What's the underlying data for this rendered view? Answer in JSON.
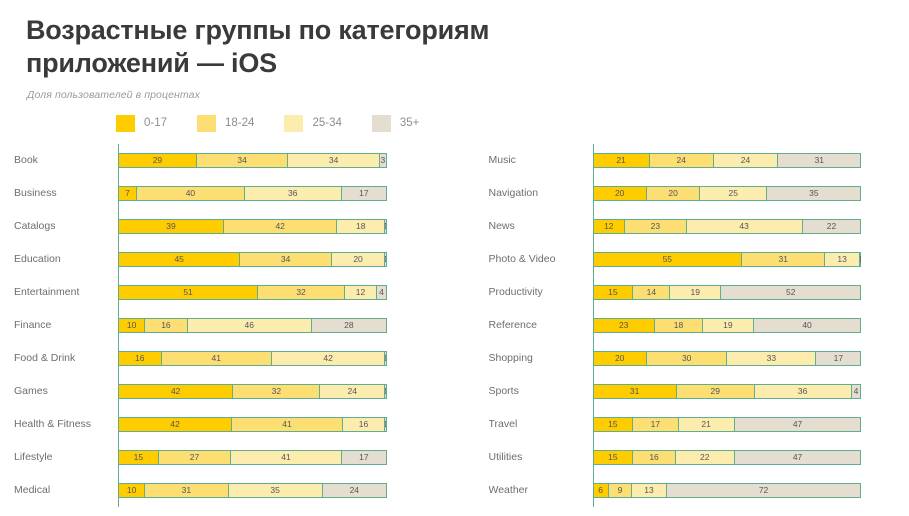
{
  "header": {
    "title": "Возрастные группы по категориям приложений — iOS",
    "subtitle": "Доля пользователей в процентах"
  },
  "legend": [
    {
      "label": "0-17",
      "color": "#FFCC00"
    },
    {
      "label": "18-24",
      "color": "#FCDE72"
    },
    {
      "label": "25-34",
      "color": "#FCEDAE"
    },
    {
      "label": "35+",
      "color": "#E4DDD0"
    }
  ],
  "chart_data": {
    "type": "bar",
    "subtype": "stacked-horizontal-100pct",
    "title": "Возрастные группы по категориям приложений — iOS",
    "subtitle": "Доля пользователей в процентах",
    "xlabel": "",
    "ylabel": "",
    "xlim": [
      0,
      100
    ],
    "unit": "%",
    "grid": false,
    "legend_position": "top",
    "series": [
      {
        "name": "0-17",
        "color": "#FFCC00"
      },
      {
        "name": "18-24",
        "color": "#FCDE72"
      },
      {
        "name": "25-34",
        "color": "#FCEDAE"
      },
      {
        "name": "35+",
        "color": "#E4DDD0"
      }
    ],
    "categories": [
      "Book",
      "Business",
      "Catalogs",
      "Education",
      "Entertainment",
      "Finance",
      "Food & Drink",
      "Games",
      "Health & Fitness",
      "Lifestyle",
      "Medical",
      "Music",
      "Navigation",
      "News",
      "Photo & Video",
      "Productivity",
      "Reference",
      "Shopping",
      "Sports",
      "Travel",
      "Utilities",
      "Weather"
    ],
    "columns": [
      {
        "rows": [
          {
            "label": "Book",
            "values": [
              29,
              34,
              34,
              3
            ]
          },
          {
            "label": "Business",
            "values": [
              7,
              40,
              36,
              17
            ]
          },
          {
            "label": "Catalogs",
            "values": [
              39,
              42,
              18,
              1
            ]
          },
          {
            "label": "Education",
            "values": [
              45,
              34,
              20,
              1
            ]
          },
          {
            "label": "Entertainment",
            "values": [
              51,
              32,
              12,
              4
            ]
          },
          {
            "label": "Finance",
            "values": [
              10,
              16,
              46,
              28
            ]
          },
          {
            "label": "Food & Drink",
            "values": [
              16,
              41,
              42,
              1
            ]
          },
          {
            "label": "Games",
            "values": [
              42,
              32,
              24,
              1
            ]
          },
          {
            "label": "Health & Fitness",
            "values": [
              42,
              41,
              16,
              1
            ]
          },
          {
            "label": "Lifestyle",
            "values": [
              15,
              27,
              41,
              17
            ]
          },
          {
            "label": "Medical",
            "values": [
              10,
              31,
              35,
              24
            ]
          }
        ]
      },
      {
        "rows": [
          {
            "label": "Music",
            "values": [
              21,
              24,
              24,
              31
            ]
          },
          {
            "label": "Navigation",
            "values": [
              20,
              20,
              25,
              35
            ]
          },
          {
            "label": "News",
            "values": [
              12,
              23,
              43,
              22
            ]
          },
          {
            "label": "Photo & Video",
            "values": [
              55,
              31,
              13,
              1
            ]
          },
          {
            "label": "Productivity",
            "values": [
              15,
              14,
              19,
              52
            ]
          },
          {
            "label": "Reference",
            "values": [
              23,
              18,
              19,
              40
            ]
          },
          {
            "label": "Shopping",
            "values": [
              20,
              30,
              33,
              17
            ]
          },
          {
            "label": "Sports",
            "values": [
              31,
              29,
              36,
              4
            ]
          },
          {
            "label": "Travel",
            "values": [
              15,
              17,
              21,
              47
            ]
          },
          {
            "label": "Utilities",
            "values": [
              15,
              16,
              22,
              47
            ]
          },
          {
            "label": "Weather",
            "values": [
              6,
              9,
              13,
              72
            ]
          }
        ]
      }
    ]
  }
}
